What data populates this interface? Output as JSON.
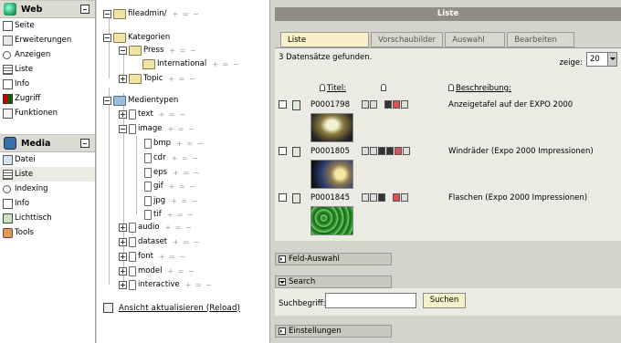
{
  "menu": {
    "groups": [
      {
        "label": "Web",
        "items": [
          "Seite",
          "Erweiterungen",
          "Anzeigen",
          "Liste",
          "Info",
          "Zugriff",
          "Funktionen"
        ]
      },
      {
        "label": "Media",
        "items": [
          "Datei",
          "Liste",
          "Indexing",
          "Info",
          "Lichttisch",
          "Tools"
        ]
      }
    ]
  },
  "tree": {
    "root": "fileadmin/",
    "kategorien": "Kategorien",
    "press": "Press",
    "international": "International",
    "topic": "Topic",
    "medientypen": "Medientypen",
    "text": "text",
    "image": "image",
    "bmp": "bmp",
    "cdr": "cdr",
    "eps": "eps",
    "gif": "gif",
    "jpg": "jpg",
    "tif": "tif",
    "audio": "audio",
    "dataset": "dataset",
    "font": "font",
    "model": "model",
    "interactive": "interactive",
    "ctl": "+ = −",
    "reload": "Ansicht aktualisieren (Reload)"
  },
  "content": {
    "title": "Liste",
    "tabs": [
      "Liste",
      "Vorschaubilder",
      "Auswahl",
      "Bearbeiten"
    ],
    "found": "3 Datensätze gefunden.",
    "zeige_label": "zeige:",
    "zeige_value": "20",
    "col_titel": "Titel:",
    "col_beschreibung": "Beschreibung:",
    "rows": [
      {
        "id": "P0001798",
        "desc": "Anzeigetafel auf der EXPO 2000"
      },
      {
        "id": "P0001805",
        "desc": "Windräder (Expo 2000 Impressionen)"
      },
      {
        "id": "P0001845",
        "desc": "Flaschen (Expo 2000 Impressionen)"
      }
    ],
    "sect_feld": "Feld-Auswahl",
    "sect_search": "Search",
    "search_label": "Suchbegriff:",
    "search_value": "",
    "search_button": "Suchen",
    "sect_einstellungen": "Einstellungen"
  }
}
